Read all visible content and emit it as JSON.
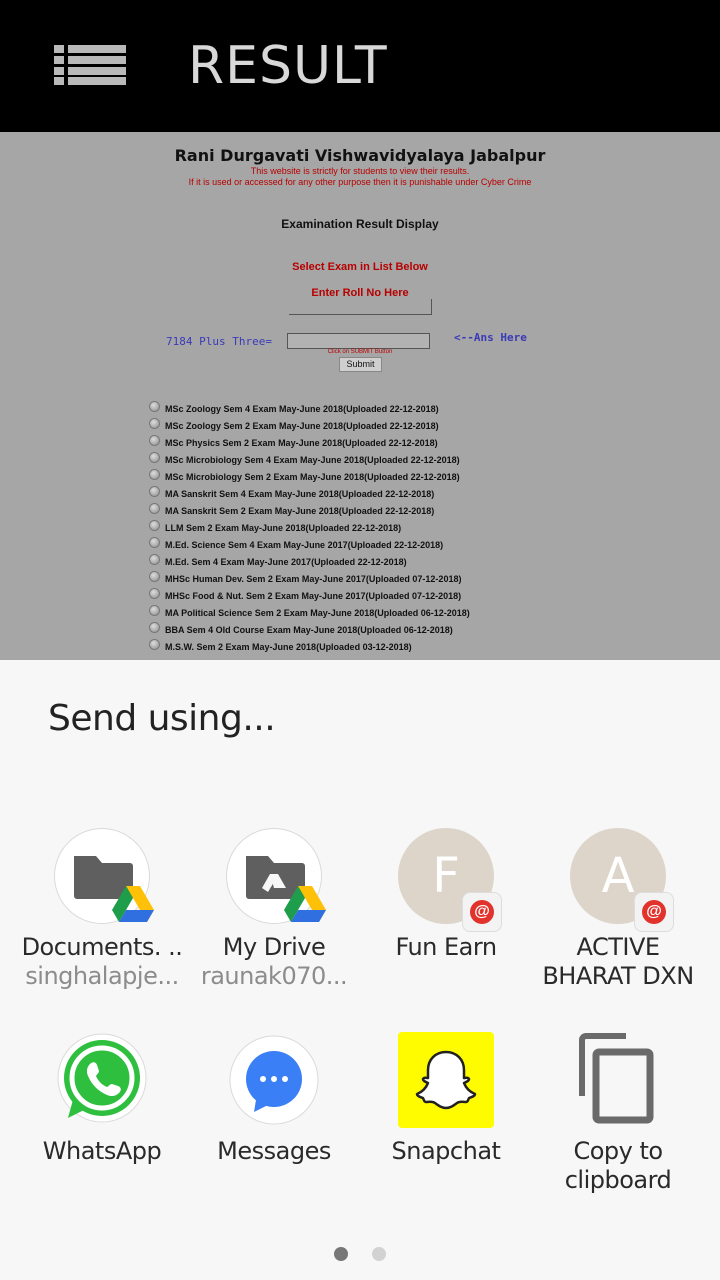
{
  "appbar": {
    "title": "RESULT"
  },
  "web": {
    "university": "Rani Durgavati Vishwavidyalaya Jabalpur",
    "warning_line1": "This website is strictly for students to view their results.",
    "warning_line2": "If it is used or accessed for any other purpose then it is punishable under Cyber Crime",
    "heading": "Examination Result Display",
    "select_exam_label": "Select Exam in List Below",
    "roll_label": "Enter Roll No Here",
    "roll_value": "",
    "captcha_question": "7184 Plus Three=",
    "captcha_value": "",
    "captcha_hint": "<--Ans Here",
    "submit_hint": "Click on SUBMIT Button",
    "submit_label": "Submit",
    "exams": [
      "MSc Zoology Sem 4 Exam May-June 2018(Uploaded 22-12-2018)",
      "MSc Zoology Sem 2 Exam May-June 2018(Uploaded 22-12-2018)",
      "MSc Physics Sem 2 Exam May-June 2018(Uploaded 22-12-2018)",
      "MSc Microbiology Sem 4 Exam May-June 2018(Uploaded 22-12-2018)",
      "MSc Microbiology Sem 2 Exam May-June 2018(Uploaded 22-12-2018)",
      "MA Sanskrit Sem 4 Exam May-June 2018(Uploaded 22-12-2018)",
      "MA Sanskrit Sem 2 Exam May-June 2018(Uploaded 22-12-2018)",
      "LLM Sem 2 Exam May-June 2018(Uploaded 22-12-2018)",
      "M.Ed. Science Sem 4 Exam May-June 2017(Uploaded 22-12-2018)",
      "M.Ed. Sem 4 Exam May-June 2017(Uploaded 22-12-2018)",
      "MHSc Human Dev. Sem 2 Exam May-June 2017(Uploaded 07-12-2018)",
      "MHSc Food & Nut. Sem 2 Exam May-June 2017(Uploaded 07-12-2018)",
      "MA Political Science Sem 2 Exam May-June 2018(Uploaded 06-12-2018)",
      "BBA Sem 4 Old Course Exam May-June 2018(Uploaded 06-12-2018)",
      "M.S.W. Sem 2 Exam May-June 2018(Uploaded 03-12-2018)"
    ]
  },
  "sheet": {
    "title": "Send using...",
    "targets": [
      {
        "name": "Documents. ..",
        "sub": "singhalapje...",
        "icon": "google-drive-folder-icon"
      },
      {
        "name": "My Drive",
        "sub": "raunak070...",
        "icon": "google-drive-shared-folder-icon"
      },
      {
        "name": "Fun Earn",
        "letter": "F",
        "icon": "email-badge-icon"
      },
      {
        "name": "ACTIVE",
        "name2": "BHARAT DXN",
        "letter": "A",
        "icon": "email-badge-icon"
      },
      {
        "name": "WhatsApp",
        "icon": "whatsapp-icon"
      },
      {
        "name": "Messages",
        "icon": "messages-icon"
      },
      {
        "name": "Snapchat",
        "icon": "snapchat-icon"
      },
      {
        "name": "Copy to",
        "name2": "clipboard",
        "icon": "copy-icon"
      }
    ],
    "badge_symbol": "@",
    "pager": {
      "pages": 2,
      "current": 1
    }
  },
  "colors": {
    "appbar_bg": "#000000",
    "web_bg": "#a6a6a6",
    "warning_red": "#b80000",
    "captcha_blue": "#3a3ab8",
    "sheet_bg": "#f7f7f7",
    "whatsapp_green": "#2fbf3f",
    "messages_blue": "#3b7ff6",
    "snapchat_yellow": "#fffc00"
  }
}
